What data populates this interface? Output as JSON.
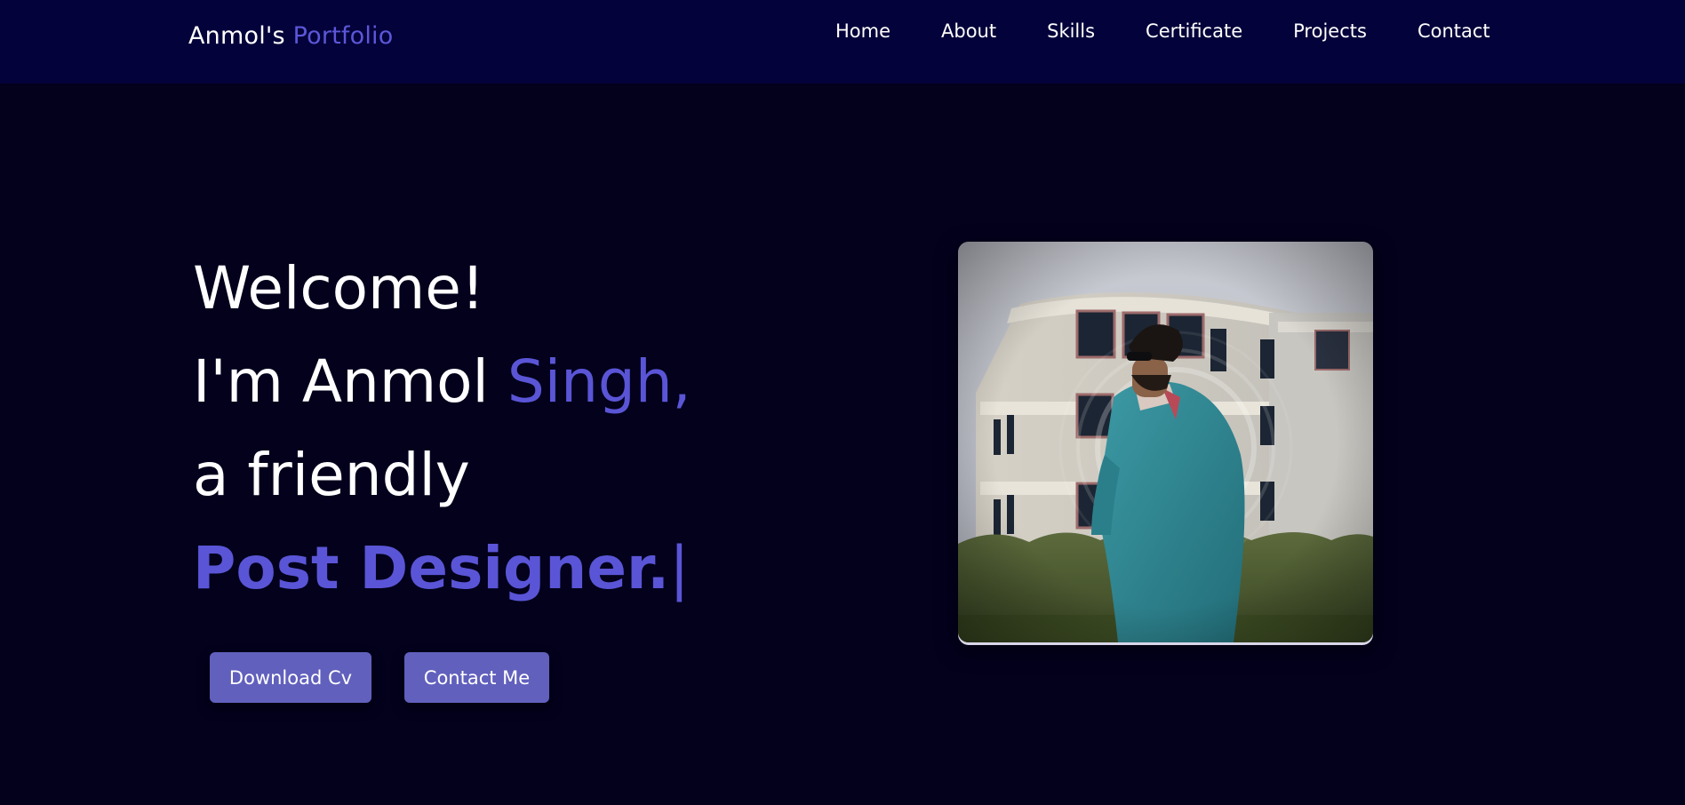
{
  "navbar": {
    "logo_name": "Anmol's",
    "logo_accent": "Portfolio",
    "links": [
      {
        "label": "Home"
      },
      {
        "label": "About"
      },
      {
        "label": "Skills"
      },
      {
        "label": "Certificate"
      },
      {
        "label": "Projects"
      },
      {
        "label": "Contact"
      }
    ]
  },
  "hero": {
    "line1": "Welcome!",
    "line2_prefix": "I'm Anmol ",
    "line2_accent": "Singh,",
    "line3": "a friendly",
    "line4_role": "Post Designer.",
    "caret": "|"
  },
  "buttons": {
    "download_cv": "Download Cv",
    "contact_me": "Contact Me"
  },
  "photo": {
    "icon": "profile-photo"
  },
  "colors": {
    "background": "#03011c",
    "navbar": "#04023a",
    "accent": "#5a55d6",
    "button": "#6160bd"
  }
}
